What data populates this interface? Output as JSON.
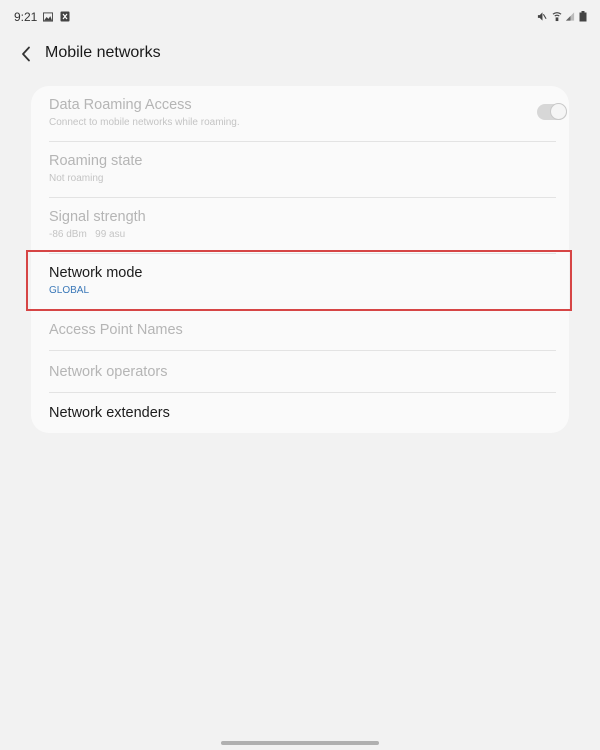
{
  "status_bar": {
    "time": "9:21",
    "left_icons": [
      "gallery-icon",
      "notification-icon"
    ],
    "right_icons": [
      "mute-icon",
      "wifi-calling-icon",
      "signal-icon",
      "battery-icon"
    ]
  },
  "header": {
    "back_icon": "chevron-left-icon",
    "title": "Mobile networks"
  },
  "settings": {
    "items": [
      {
        "title": "Data Roaming Access",
        "subtitle": "Connect to mobile networks while roaming.",
        "enabled": false,
        "toggle_on": true
      },
      {
        "title": "Roaming state",
        "subtitle": "Not roaming",
        "enabled": false
      },
      {
        "title": "Signal strength",
        "subtitle": "-86 dBm   99 asu",
        "enabled": false
      },
      {
        "title": "Network mode",
        "subtitle": "GLOBAL",
        "enabled": true,
        "highlighted": true
      },
      {
        "title": "Access Point Names",
        "enabled": false
      },
      {
        "title": "Network operators",
        "enabled": false
      },
      {
        "title": "Network extenders",
        "enabled": true
      }
    ]
  },
  "colors": {
    "background": "#f2f2f2",
    "card": "#fafafa",
    "highlight_border": "#d64545",
    "accent_subtitle": "#3a78b8"
  }
}
